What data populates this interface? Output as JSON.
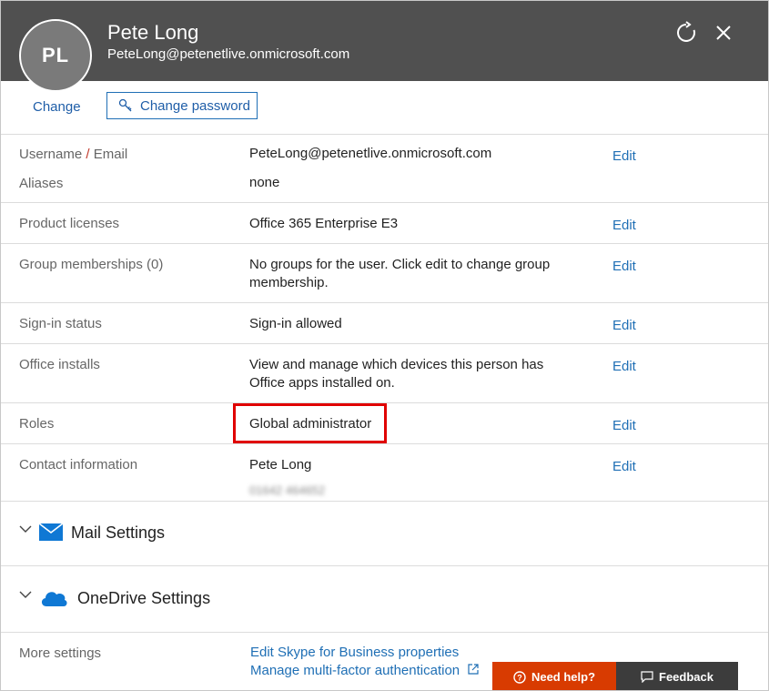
{
  "header": {
    "initials": "PL",
    "name": "Pete Long",
    "email": "PeteLong@petenetlive.onmicrosoft.com"
  },
  "actions": {
    "change_label": "Change",
    "change_password_label": "Change password"
  },
  "details": {
    "username_label": "Username",
    "username_sep": " / ",
    "email_label": "Email",
    "username_value": "PeteLong@petenetlive.onmicrosoft.com",
    "aliases_label": "Aliases",
    "aliases_value": "none",
    "licenses_label": "Product licenses",
    "licenses_value": "Office 365 Enterprise E3",
    "groups_label": "Group memberships (0)",
    "groups_value": "No groups for the user. Click edit to change group membership.",
    "signin_label": "Sign-in status",
    "signin_value": "Sign-in allowed",
    "office_label": "Office installs",
    "office_value": "View and manage which devices this person has Office apps installed on.",
    "roles_label": "Roles",
    "roles_value": "Global administrator",
    "contact_label": "Contact information",
    "contact_name": "Pete Long",
    "contact_phone": "01642 464652",
    "edit_label": "Edit"
  },
  "sections": {
    "mail": "Mail Settings",
    "onedrive": "OneDrive Settings"
  },
  "more": {
    "label": "More settings",
    "skype_link": "Edit Skype for Business properties",
    "mfa_link": "Manage multi-factor authentication"
  },
  "footer": {
    "help": "Need help?",
    "feedback": "Feedback"
  },
  "colors": {
    "header_bg": "#505050",
    "link": "#1f6fb5",
    "highlight": "#e00000",
    "help_bg": "#d83b01",
    "feedback_bg": "#3c3c3c",
    "mail_icon": "#0f78d4",
    "onedrive_icon": "#0f78d4"
  },
  "icons": {
    "refresh": "refresh-icon",
    "close": "close-icon",
    "key": "key-icon",
    "mail": "mail-icon",
    "onedrive": "cloud-icon",
    "chevron": "chevron-down-icon",
    "external": "external-link-icon",
    "help": "question-circle-icon",
    "feedback": "comment-icon"
  }
}
